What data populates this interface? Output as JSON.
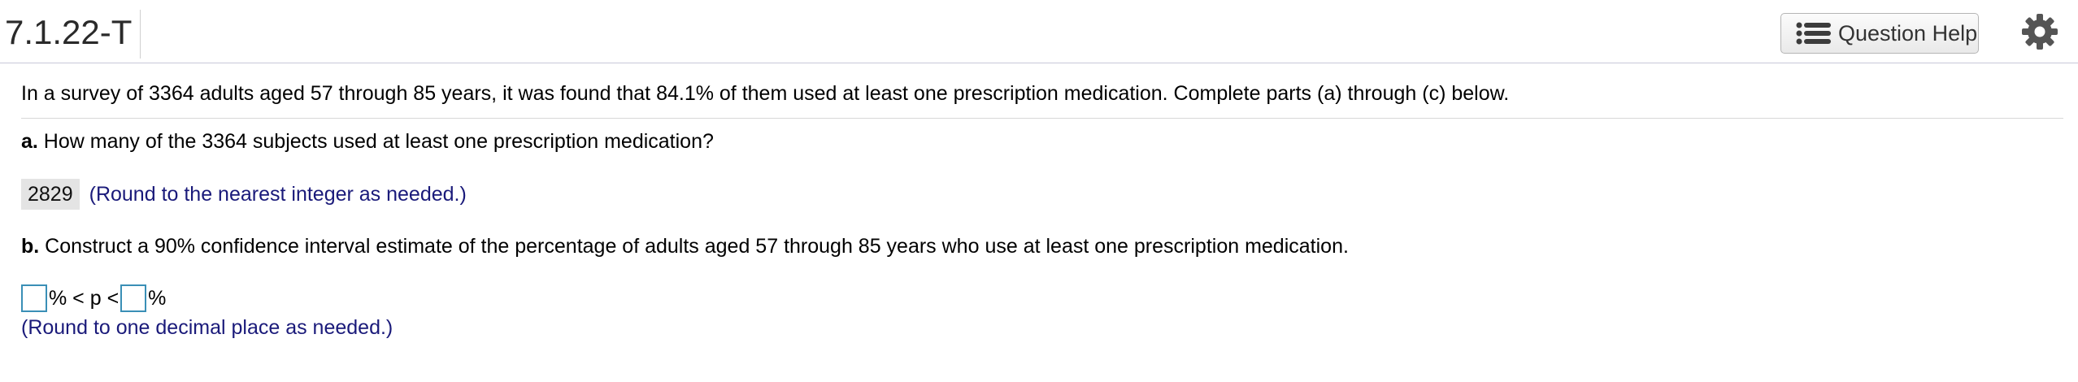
{
  "header": {
    "question_id": "7.1.22-T",
    "help_label": "Question Help"
  },
  "content": {
    "intro": "In a survey of 3364 adults aged 57 through 85 years, it was found that 84.1% of them used at least one prescription medication. Complete parts (a) through (c) below.",
    "part_a": {
      "label": "a.",
      "question": " How many of the 3364 subjects used at least one prescription medication?",
      "answer": "2829",
      "hint": "(Round to the nearest integer as needed.)"
    },
    "part_b": {
      "label": "b.",
      "question": " Construct a 90% confidence interval estimate of the percentage of adults aged 57 through 85 years who use at least one prescription medication.",
      "middle": "% < p <",
      "suffix": "%",
      "hint": "(Round to one decimal place as needed.)"
    }
  },
  "colors": {
    "hint_text": "#1a1a7a",
    "input_border": "#3a8fb6"
  },
  "icons": {
    "help": "list-icon",
    "settings": "gear-icon"
  }
}
